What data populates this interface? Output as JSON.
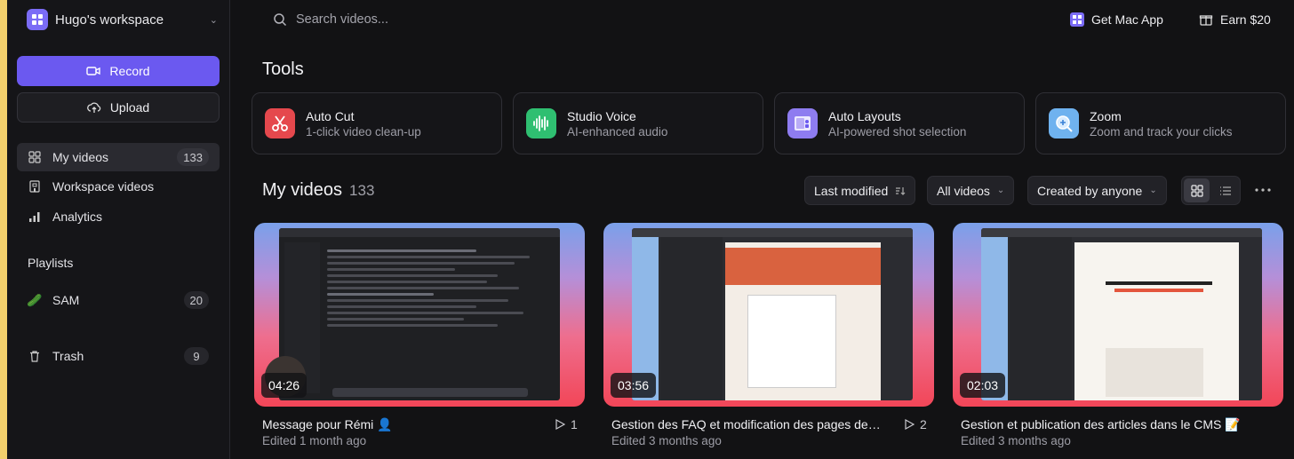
{
  "sidebar": {
    "workspace_name": "Hugo's workspace",
    "record_label": "Record",
    "upload_label": "Upload",
    "nav": [
      {
        "label": "My videos",
        "count": "133",
        "icon": "grid-icon"
      },
      {
        "label": "Workspace videos",
        "icon": "building-icon"
      },
      {
        "label": "Analytics",
        "icon": "bar-chart-icon"
      }
    ],
    "playlists_heading": "Playlists",
    "playlists": [
      {
        "label": "SAM",
        "count": "20",
        "emoji": "🥒"
      }
    ],
    "trash": {
      "label": "Trash",
      "count": "9"
    }
  },
  "header": {
    "search_placeholder": "Search videos...",
    "mac_app_label": "Get Mac App",
    "earn_label": "Earn $20"
  },
  "tools": {
    "heading": "Tools",
    "items": [
      {
        "title": "Auto Cut",
        "subtitle": "1-click video clean-up",
        "icon": "scissors-icon",
        "color": "#e5484d"
      },
      {
        "title": "Studio Voice",
        "subtitle": "AI-enhanced audio",
        "icon": "waveform-icon",
        "color": "#2fbf71"
      },
      {
        "title": "Auto Layouts",
        "subtitle": "AI-powered shot selection",
        "icon": "layout-icon",
        "color": "#8e7cf0"
      },
      {
        "title": "Zoom",
        "subtitle": "Zoom and track your clicks",
        "icon": "magnifier-icon",
        "color": "#6fb2ef"
      }
    ]
  },
  "videos": {
    "heading": "My videos",
    "count": "133",
    "sort_label": "Last modified",
    "filter_label": "All videos",
    "creator_label": "Created by anyone",
    "items": [
      {
        "title": "Message pour Rémi 👤",
        "edited": "Edited 1 month ago",
        "duration": "04:26",
        "views": "1"
      },
      {
        "title": "Gestion des FAQ et modification des pages de…",
        "edited": "Edited 3 months ago",
        "duration": "03:56",
        "views": "2"
      },
      {
        "title": "Gestion et publication des articles dans le CMS 📝",
        "edited": "Edited 3 months ago",
        "duration": "02:03"
      }
    ]
  },
  "colors": {
    "accent": "#6b59f0",
    "background": "#121214"
  }
}
